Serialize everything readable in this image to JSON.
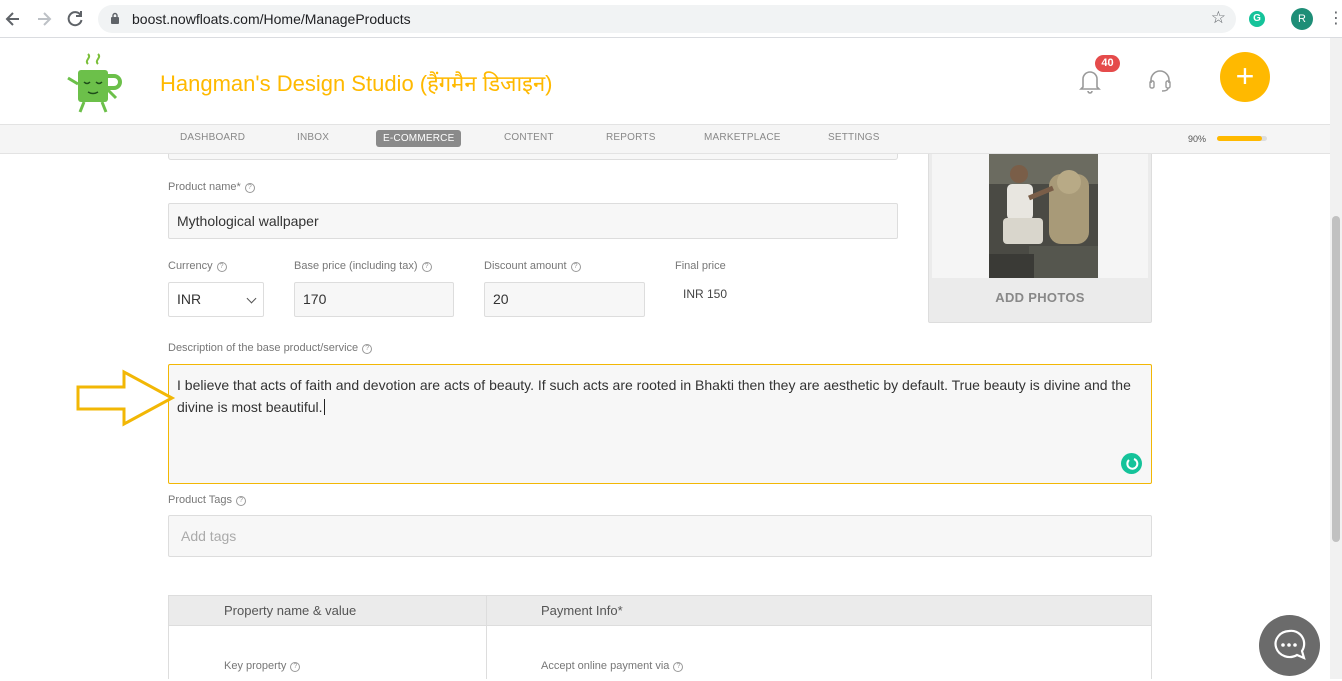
{
  "browser": {
    "url": "boost.nowfloats.com/Home/ManageProducts",
    "extension_letter": "G",
    "profile_initial": "R"
  },
  "header": {
    "business_name": "Hangman's Design Studio (हैंगमैन डिजाइन)",
    "notification_count": "40",
    "add_label": "+"
  },
  "nav": {
    "tabs": [
      "DASHBOARD",
      "INBOX",
      "E-COMMERCE",
      "CONTENT",
      "REPORTS",
      "MARKETPLACE",
      "SETTINGS"
    ],
    "active_tab": "E-COMMERCE",
    "profile_completion": "90%",
    "profile_completion_value": 0.9
  },
  "form": {
    "product_name_label": "Product name*",
    "product_name_value": "Mythological wallpaper",
    "currency_label": "Currency",
    "currency_value": "INR",
    "base_price_label": "Base price (including tax)",
    "base_price_value": "170",
    "discount_label": "Discount amount",
    "discount_value": "20",
    "final_price_label": "Final price",
    "final_price_value": "INR 150",
    "description_label": "Description of the base product/service",
    "description_value": "I believe that acts of faith and devotion are acts of beauty. If such acts are rooted in Bhakti then they are aesthetic by default. True beauty is divine and the divine is most beautiful.",
    "tags_label": "Product Tags",
    "tags_placeholder": "Add tags"
  },
  "photos": {
    "add_photos_label": "ADD PHOTOS"
  },
  "table": {
    "col1_header": "Property name & value",
    "col2_header": "Payment Info*",
    "key_property_label": "Key property",
    "accept_payment_label": "Accept online payment via"
  },
  "help_glyph": "?",
  "colors": {
    "brand": "#ffb900",
    "badge": "#e54b4b",
    "grammarly": "#15c39a",
    "active_tab": "#8a8a8a"
  }
}
